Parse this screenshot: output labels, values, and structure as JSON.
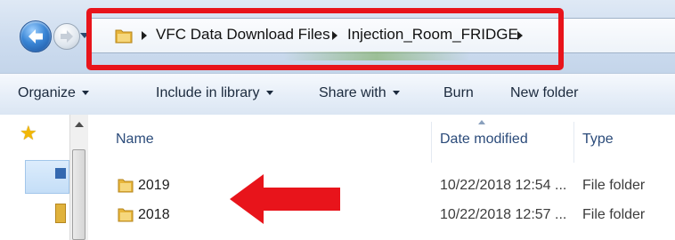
{
  "address_bar": {
    "crumbs": [
      "VFC Data Download Files",
      "Injection_Room_FRIDGE"
    ]
  },
  "toolbar": {
    "organize": "Organize",
    "include_in_library": "Include in library",
    "share_with": "Share with",
    "burn": "Burn",
    "new_folder": "New folder"
  },
  "columns": {
    "name": "Name",
    "date_modified": "Date modified",
    "type": "Type"
  },
  "files": [
    {
      "name": "2019",
      "date": "10/22/2018 12:54 ...",
      "type": "File folder"
    },
    {
      "name": "2018",
      "date": "10/22/2018 12:57 ...",
      "type": "File folder"
    }
  ],
  "colors": {
    "annotation_red": "#e8141b",
    "folder_yellow": "#e7b53b"
  },
  "icons": [
    "back-arrow-icon",
    "forward-arrow-icon",
    "folder-icon",
    "star-icon",
    "annotation-arrow-icon"
  ]
}
